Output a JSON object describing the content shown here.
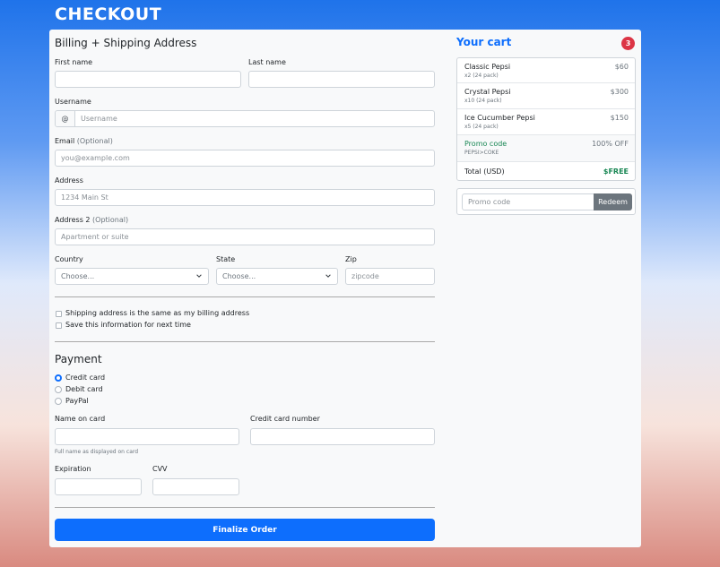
{
  "page": {
    "title": "CHECKOUT"
  },
  "billing": {
    "heading": "Billing + Shipping Address",
    "first_name": {
      "label": "First name",
      "value": ""
    },
    "last_name": {
      "label": "Last name",
      "value": ""
    },
    "username": {
      "label": "Username",
      "prefix": "@",
      "placeholder": "Username"
    },
    "email": {
      "label": "Email",
      "optional": "(Optional)",
      "placeholder": "you@example.com"
    },
    "address": {
      "label": "Address",
      "placeholder": "1234 Main St"
    },
    "address2": {
      "label": "Address 2",
      "optional": "(Optional)",
      "placeholder": "Apartment or suite"
    },
    "country": {
      "label": "Country",
      "selected": "Choose..."
    },
    "state": {
      "label": "State",
      "selected": "Choose..."
    },
    "zip": {
      "label": "Zip",
      "placeholder": "zipcode"
    },
    "same_address_label": "Shipping address is the same as my billing address",
    "save_info_label": "Save this information for next time"
  },
  "payment": {
    "heading": "Payment",
    "methods": [
      {
        "label": "Credit card",
        "selected": true
      },
      {
        "label": "Debit card",
        "selected": false
      },
      {
        "label": "PayPal",
        "selected": false
      }
    ],
    "name_on_card": {
      "label": "Name on card",
      "help": "Full name as displayed on card"
    },
    "card_number": {
      "label": "Credit card number"
    },
    "expiration": {
      "label": "Expiration"
    },
    "cvv": {
      "label": "CVV"
    },
    "submit_label": "Finalize Order"
  },
  "cart": {
    "title": "Your cart",
    "count": "3",
    "items": [
      {
        "name": "Classic Pepsi",
        "desc": "x2 (24 pack)",
        "price": "$60"
      },
      {
        "name": "Crystal Pepsi",
        "desc": "x10 (24 pack)",
        "price": "$300"
      },
      {
        "name": "Ice Cucumber Pepsi",
        "desc": "x5 (24 pack)",
        "price": "$150"
      }
    ],
    "promo": {
      "name": "Promo code",
      "code": "PEPSI>COKE",
      "value": "100% OFF"
    },
    "total": {
      "label": "Total (USD)",
      "value": "$FREE"
    },
    "redeem": {
      "placeholder": "Promo code",
      "button_label": "Redeem"
    }
  },
  "colors": {
    "primary": "#0d6efd",
    "badge": "#dc3545",
    "success": "#198754",
    "secondary": "#6c757d"
  }
}
